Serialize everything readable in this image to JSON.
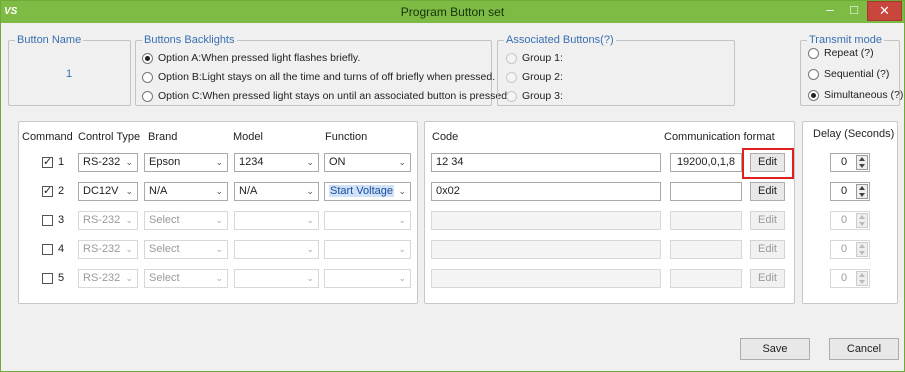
{
  "window": {
    "logo": "VS",
    "title": "Program Button set",
    "min_glyph": "–",
    "max_glyph": "□",
    "close_glyph": "✕"
  },
  "button_name": {
    "legend": "Button  Name",
    "value": "1"
  },
  "backlights": {
    "legend": "Buttons Backlights",
    "options": [
      {
        "label": "Option A:When pressed light flashes briefly.",
        "selected": true
      },
      {
        "label": "Option B:Light stays on all the time and turns of off briefly when pressed.",
        "selected": false
      },
      {
        "label": "Option C:When pressed light stays on until an associated button is pressed.",
        "selected": false
      }
    ]
  },
  "associated": {
    "legend": "Associated Buttons(?)",
    "groups": [
      "Group 1:",
      "Group 2:",
      "Group 3:"
    ]
  },
  "transmit": {
    "legend": "Transmit mode",
    "options": [
      {
        "label": "Repeat (?)",
        "selected": false
      },
      {
        "label": "Sequential (?)",
        "selected": false
      },
      {
        "label": "Simultaneous (?)",
        "selected": true
      }
    ]
  },
  "headers": {
    "command": "Command",
    "control_type": "Control Type",
    "brand": "Brand",
    "model": "Model",
    "function": "Function",
    "code": "Code",
    "comm_format": "Communication format",
    "delay": "Delay (Seconds)"
  },
  "rows": [
    {
      "num": "1",
      "checked": true,
      "enabled": true,
      "control_type": "RS-232",
      "brand": "Epson",
      "model": "1234",
      "function": "ON",
      "function_highlighted": false,
      "code": "12 34",
      "comm_format": "19200,0,1,8",
      "edit": "Edit",
      "delay": "0"
    },
    {
      "num": "2",
      "checked": true,
      "enabled": true,
      "control_type": "DC12V",
      "brand": "N/A",
      "model": "N/A",
      "function": "Start Voltage",
      "function_highlighted": true,
      "code": "0x02",
      "comm_format": "",
      "edit": "Edit",
      "delay": "0"
    },
    {
      "num": "3",
      "checked": false,
      "enabled": false,
      "control_type": "RS-232",
      "brand": "Select",
      "model": "",
      "function": "",
      "function_highlighted": false,
      "code": "",
      "comm_format": "",
      "edit": "Edit",
      "delay": "0"
    },
    {
      "num": "4",
      "checked": false,
      "enabled": false,
      "control_type": "RS-232",
      "brand": "Select",
      "model": "",
      "function": "",
      "function_highlighted": false,
      "code": "",
      "comm_format": "",
      "edit": "Edit",
      "delay": "0"
    },
    {
      "num": "5",
      "checked": false,
      "enabled": false,
      "control_type": "RS-232",
      "brand": "Select",
      "model": "",
      "function": "",
      "function_highlighted": false,
      "code": "",
      "comm_format": "",
      "edit": "Edit",
      "delay": "0"
    }
  ],
  "chevron_glyph": "⌄",
  "footer": {
    "save": "Save",
    "cancel": "Cancel"
  },
  "colors": {
    "titlebar": "#7dbb45",
    "legend": "#3a6fb0",
    "highlight": "#e01f1f"
  }
}
